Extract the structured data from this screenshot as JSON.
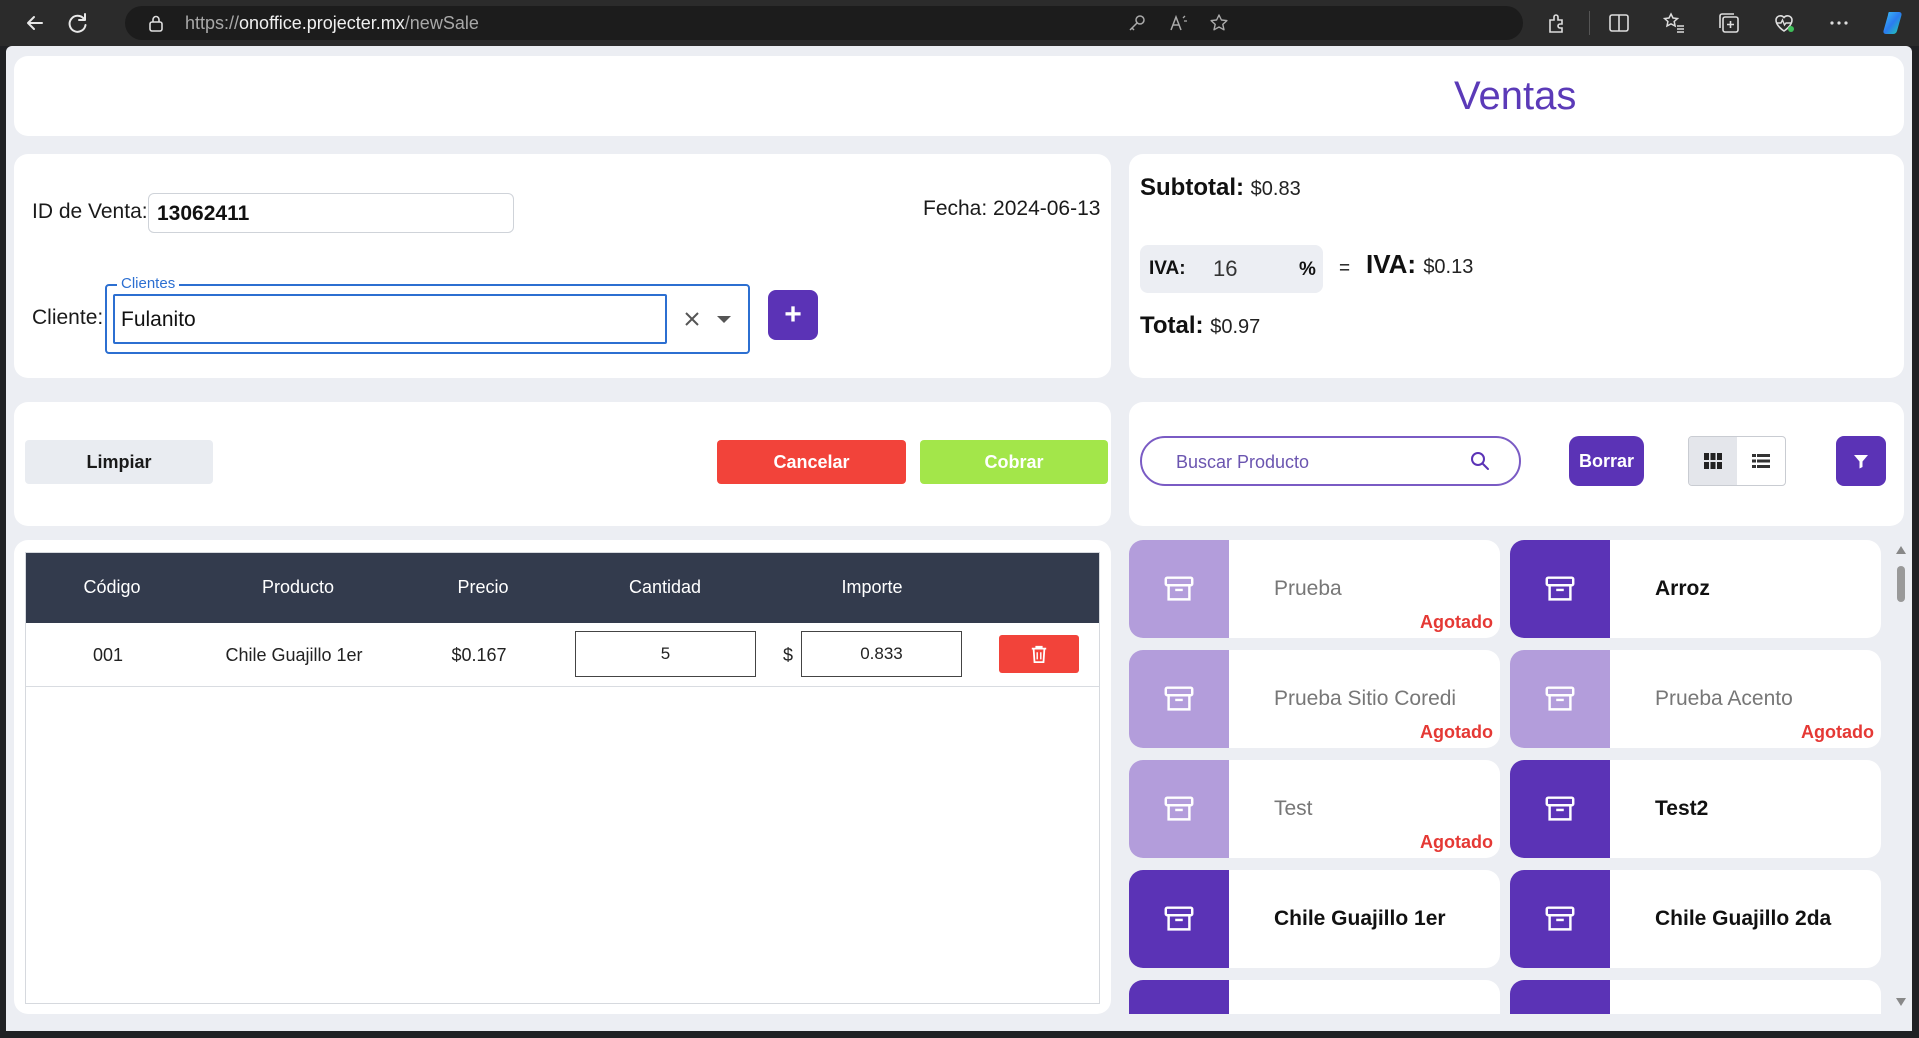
{
  "browser": {
    "url_scheme": "https://",
    "url_host": "onoffice.projecter.mx",
    "url_path": "/newSale"
  },
  "page": {
    "title": "Ventas"
  },
  "sale": {
    "id_label": "ID de Venta:",
    "id_value": "13062411",
    "date_label": "Fecha:",
    "date_value": "2024-06-13",
    "client_label": "Cliente:",
    "client_field_legend": "Clientes",
    "client_value": "Fulanito",
    "add_client_label": "+"
  },
  "totals": {
    "subtotal_label": "Subtotal:",
    "subtotal_value": "$0.83",
    "iva_label": "IVA:",
    "iva_rate": "16",
    "iva_percent_sign": "%",
    "equals": "=",
    "iva_amount_label": "IVA:",
    "iva_amount_value": "$0.13",
    "total_label": "Total:",
    "total_value": "$0.97"
  },
  "actions": {
    "clear": "Limpiar",
    "cancel": "Cancelar",
    "charge": "Cobrar"
  },
  "search": {
    "placeholder": "Buscar Producto",
    "clear_button": "Borrar"
  },
  "table": {
    "headers": [
      "Código",
      "Producto",
      "Precio",
      "Cantidad",
      "Importe"
    ],
    "rows": [
      {
        "code": "001",
        "product": "Chile Guajillo 1er",
        "price": "$0.167",
        "quantity": "5",
        "currency": "$",
        "amount": "0.833"
      }
    ]
  },
  "products": [
    {
      "name": "Prueba",
      "status": "Agotado"
    },
    {
      "name": "Arroz",
      "status": ""
    },
    {
      "name": "Prueba Sitio Coredi",
      "status": "Agotado"
    },
    {
      "name": "Prueba Acento",
      "status": "Agotado"
    },
    {
      "name": "Test",
      "status": "Agotado"
    },
    {
      "name": "Test2",
      "status": ""
    },
    {
      "name": "Chile Guajillo 1er",
      "status": ""
    },
    {
      "name": "Chile Guajillo 2da",
      "status": ""
    },
    {
      "name": "",
      "status": ""
    },
    {
      "name": "",
      "status": ""
    }
  ],
  "colors": {
    "brand_purple": "#5b33b6",
    "light_purple": "#b39ddb",
    "danger": "#f2433a",
    "success": "#a3e64a",
    "table_header": "#333b4d"
  }
}
